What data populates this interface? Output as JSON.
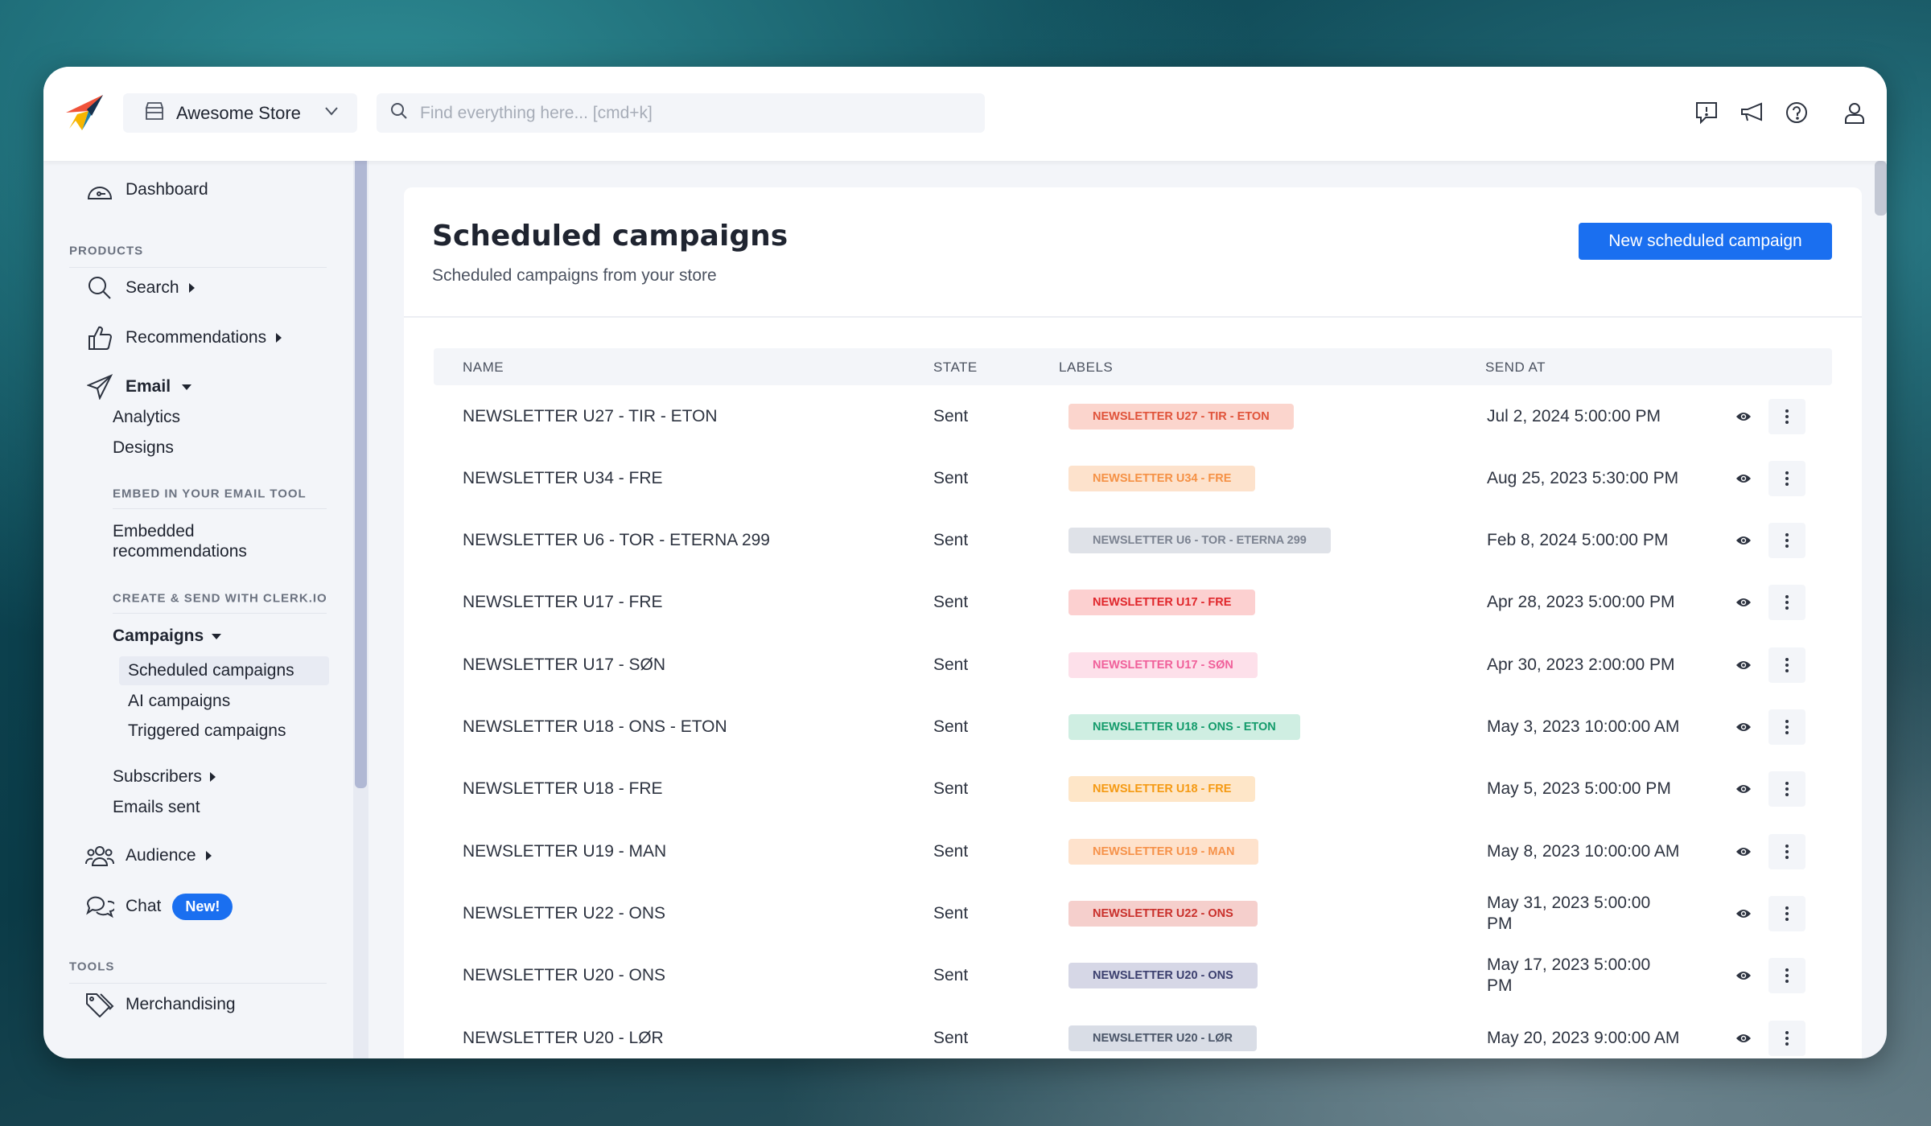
{
  "header": {
    "store_name": "Awesome Store",
    "search_placeholder": "Find everything here... [cmd+k]",
    "icons": [
      "feedback-icon",
      "megaphone-icon",
      "help-icon",
      "user-icon"
    ]
  },
  "sidebar": {
    "dashboard": "Dashboard",
    "products_heading": "PRODUCTS",
    "search": "Search",
    "recommendations": "Recommendations",
    "email": "Email",
    "analytics": "Analytics",
    "designs": "Designs",
    "embed_heading": "EMBED IN YOUR EMAIL TOOL",
    "embedded_line1": "Embedded",
    "embedded_line2": "recommendations",
    "create_heading": "CREATE & SEND WITH CLERK.IO",
    "campaigns": "Campaigns",
    "scheduled_campaigns": "Scheduled campaigns",
    "ai_campaigns": "AI campaigns",
    "triggered_campaigns": "Triggered campaigns",
    "subscribers": "Subscribers",
    "emails_sent": "Emails sent",
    "audience": "Audience",
    "chat": "Chat",
    "chat_badge": "New!",
    "tools_heading": "TOOLS",
    "merchandising": "Merchandising"
  },
  "main": {
    "title": "Scheduled campaigns",
    "subtitle": "Scheduled campaigns from your store",
    "new_button": "New scheduled campaign",
    "columns": {
      "name": "NAME",
      "state": "STATE",
      "labels": "LABELS",
      "send_at": "SEND AT"
    },
    "rows": [
      {
        "name": "NEWSLETTER U27 - TIR - ETON",
        "state": "Sent",
        "label": "NEWSLETTER U27 - TIR - ETON",
        "label_bg": "#fbd5cd",
        "label_fg": "#e0533a",
        "send_at": "Jul 2, 2024 5:00:00 PM"
      },
      {
        "name": "NEWSLETTER U34 - FRE",
        "state": "Sent",
        "label": "NEWSLETTER U34 - FRE",
        "label_bg": "#fde2cc",
        "label_fg": "#f59145",
        "send_at": "Aug 25, 2023 5:30:00 PM"
      },
      {
        "name": "NEWSLETTER U6 - TOR - ETERNA 299",
        "state": "Sent",
        "label": "NEWSLETTER U6 - TOR - ETERNA 299",
        "label_bg": "#dfe2e8",
        "label_fg": "#7c8391",
        "send_at": "Feb 8, 2024 5:00:00 PM"
      },
      {
        "name": "NEWSLETTER U17 - FRE",
        "state": "Sent",
        "label": "NEWSLETTER U17 - FRE",
        "label_bg": "#fcd0d0",
        "label_fg": "#e0262b",
        "send_at": "Apr 28, 2023 5:00:00 PM"
      },
      {
        "name": "NEWSLETTER U17 - SØN",
        "state": "Sent",
        "label": "NEWSLETTER U17 - SØN",
        "label_bg": "#fde0ea",
        "label_fg": "#f0609a",
        "send_at": "Apr 30, 2023 2:00:00 PM"
      },
      {
        "name": "NEWSLETTER U18 - ONS - ETON",
        "state": "Sent",
        "label": "NEWSLETTER U18 - ONS - ETON",
        "label_bg": "#cfeee2",
        "label_fg": "#139b6b",
        "send_at": "May 3, 2023 10:00:00 AM"
      },
      {
        "name": "NEWSLETTER U18 - FRE",
        "state": "Sent",
        "label": "NEWSLETTER U18 - FRE",
        "label_bg": "#fee6c8",
        "label_fg": "#f59a13",
        "send_at": "May 5, 2023 5:00:00 PM"
      },
      {
        "name": "NEWSLETTER U19 - MAN",
        "state": "Sent",
        "label": "NEWSLETTER U19 - MAN",
        "label_bg": "#fee2cc",
        "label_fg": "#f6924a",
        "send_at": "May 8, 2023 10:00:00 AM"
      },
      {
        "name": "NEWSLETTER U22 - ONS",
        "state": "Sent",
        "label": "NEWSLETTER U22 - ONS",
        "label_bg": "#f5cfcc",
        "label_fg": "#c9302b",
        "send_at": "May 31, 2023 5:00:00 PM"
      },
      {
        "name": "NEWSLETTER U20 - ONS",
        "state": "Sent",
        "label": "NEWSLETTER U20 - ONS",
        "label_bg": "#d6d7e6",
        "label_fg": "#3b3f6e",
        "send_at": "May 17, 2023 5:00:00 PM"
      },
      {
        "name": "NEWSLETTER U20 - LØR",
        "state": "Sent",
        "label": "NEWSLETTER U20 - LØR",
        "label_bg": "#d9dde6",
        "label_fg": "#4a5568",
        "send_at": "May 20, 2023 9:00:00 AM"
      }
    ]
  },
  "colors": {
    "accent": "#1a6ff0"
  }
}
